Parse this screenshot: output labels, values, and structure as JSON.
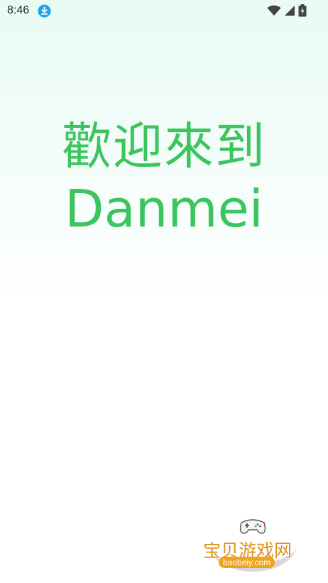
{
  "status_bar": {
    "time": "8:46",
    "download_icon": "download-icon",
    "wifi_icon": "wifi-icon",
    "signal_icon": "signal-icon",
    "battery_icon": "battery-charging-icon"
  },
  "welcome": {
    "line1": "歡迎來到",
    "line2": "Danmei"
  },
  "watermark": {
    "title": "宝贝游戏网",
    "url": "baobeiy.com",
    "icon": "gamepad-icon"
  },
  "colors": {
    "accent_green": "#3cc45e",
    "watermark_orange": "#e0901c",
    "download_blue": "#1aa3f0"
  }
}
